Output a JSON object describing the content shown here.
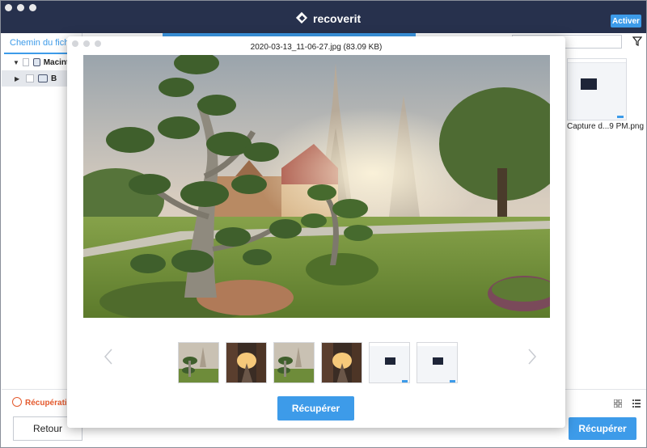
{
  "app": {
    "brand": "recoverit",
    "activate_label": "Activer"
  },
  "sidebar": {
    "tab_label": "Chemin du fichier",
    "tree": [
      {
        "label": "Macintosh HD",
        "expanded": true
      },
      {
        "label": "B",
        "expanded": false
      }
    ]
  },
  "search": {
    "placeholder": "r"
  },
  "file_grid": {
    "caption": "Capture d...9 PM.png"
  },
  "bottom": {
    "status_label": "Récupération",
    "back_label": "Retour",
    "recover_label": "Récupérer"
  },
  "preview": {
    "title": "2020-03-13_11-06-27.jpg (83.09 KB)",
    "recover_label": "Récupérer",
    "thumbnails": [
      "temple",
      "street",
      "temple",
      "street",
      "screenshot",
      "screenshot"
    ]
  },
  "colors": {
    "titlebar": "#27314d",
    "accent": "#3d9be9",
    "status": "#e45a2e"
  }
}
